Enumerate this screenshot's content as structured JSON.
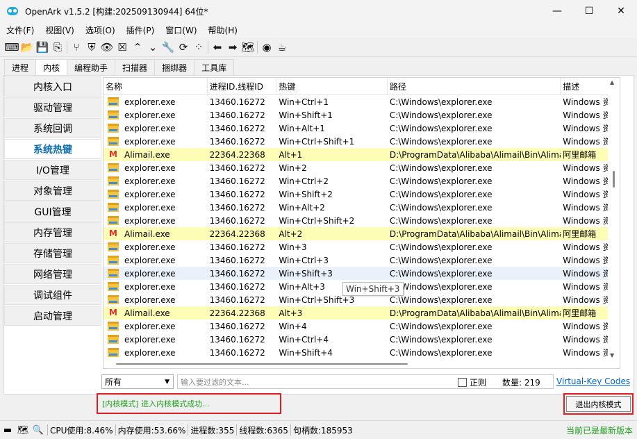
{
  "window": {
    "title": "OpenArk v1.5.2 [构建:202509130944]  64位*",
    "minimize": "—",
    "maximize": "☐",
    "close": "✕"
  },
  "menu": [
    "文件(F)",
    "视图(V)",
    "选项(O)",
    "插件(P)",
    "窗口(W)",
    "帮助(H)"
  ],
  "toolbar": {
    "icons": [
      "console-icon",
      "open-folder-icon",
      "save-icon",
      "export-icon",
      "process-tree-icon",
      "shield-icon",
      "eye-icon",
      "kill-icon",
      "up-arrow-icon",
      "down-arrow-icon",
      "wrench-icon",
      "refresh-icon",
      "grid-icon",
      "back-arrow-icon",
      "forward-arrow-icon",
      "map-icon",
      "github-icon",
      "coffee-icon"
    ]
  },
  "tabs": [
    "进程",
    "内核",
    "编程助手",
    "扫描器",
    "捆绑器",
    "工具库"
  ],
  "active_tab": "内核",
  "sidebar": [
    "内核入口",
    "驱动管理",
    "系统回调",
    "系统热键",
    "I/O管理",
    "对象管理",
    "GUI管理",
    "内存管理",
    "存储管理",
    "网络管理",
    "调试组件",
    "启动管理"
  ],
  "sidebar_active": "系统热键",
  "table": {
    "columns": [
      "名称",
      "进程ID.线程ID",
      "热键",
      "路径",
      "描述"
    ],
    "rows": [
      {
        "icon": "folder",
        "name": "explorer.exe",
        "pid": "13460.16272",
        "hotkey": "Win+Ctrl+1",
        "path": "C:\\Windows\\explorer.exe",
        "desc": "Windows 资源管理器"
      },
      {
        "icon": "folder",
        "name": "explorer.exe",
        "pid": "13460.16272",
        "hotkey": "Win+Shift+1",
        "path": "C:\\Windows\\explorer.exe",
        "desc": "Windows 资源管理器"
      },
      {
        "icon": "folder",
        "name": "explorer.exe",
        "pid": "13460.16272",
        "hotkey": "Win+Alt+1",
        "path": "C:\\Windows\\explorer.exe",
        "desc": "Windows 资源管理器"
      },
      {
        "icon": "folder",
        "name": "explorer.exe",
        "pid": "13460.16272",
        "hotkey": "Win+Ctrl+Shift+1",
        "path": "C:\\Windows\\explorer.exe",
        "desc": "Windows 资源管理器"
      },
      {
        "icon": "mail",
        "name": "Alimail.exe",
        "pid": "22364.22368",
        "hotkey": "Alt+1",
        "path": "D:\\ProgramData\\Alibaba\\Alimail\\Bin\\Alimail.exe",
        "desc": "阿里邮箱",
        "highlight": true
      },
      {
        "icon": "folder",
        "name": "explorer.exe",
        "pid": "13460.16272",
        "hotkey": "Win+2",
        "path": "C:\\Windows\\explorer.exe",
        "desc": "Windows 资源管理器"
      },
      {
        "icon": "folder",
        "name": "explorer.exe",
        "pid": "13460.16272",
        "hotkey": "Win+Ctrl+2",
        "path": "C:\\Windows\\explorer.exe",
        "desc": "Windows 资源管理器"
      },
      {
        "icon": "folder",
        "name": "explorer.exe",
        "pid": "13460.16272",
        "hotkey": "Win+Shift+2",
        "path": "C:\\Windows\\explorer.exe",
        "desc": "Windows 资源管理器"
      },
      {
        "icon": "folder",
        "name": "explorer.exe",
        "pid": "13460.16272",
        "hotkey": "Win+Alt+2",
        "path": "C:\\Windows\\explorer.exe",
        "desc": "Windows 资源管理器"
      },
      {
        "icon": "folder",
        "name": "explorer.exe",
        "pid": "13460.16272",
        "hotkey": "Win+Ctrl+Shift+2",
        "path": "C:\\Windows\\explorer.exe",
        "desc": "Windows 资源管理器"
      },
      {
        "icon": "mail",
        "name": "Alimail.exe",
        "pid": "22364.22368",
        "hotkey": "Alt+2",
        "path": "D:\\ProgramData\\Alibaba\\Alimail\\Bin\\Alimail.exe",
        "desc": "阿里邮箱",
        "highlight": true
      },
      {
        "icon": "folder",
        "name": "explorer.exe",
        "pid": "13460.16272",
        "hotkey": "Win+3",
        "path": "C:\\Windows\\explorer.exe",
        "desc": "Windows 资源管理器"
      },
      {
        "icon": "folder",
        "name": "explorer.exe",
        "pid": "13460.16272",
        "hotkey": "Win+Ctrl+3",
        "path": "C:\\Windows\\explorer.exe",
        "desc": "Windows 资源管理器"
      },
      {
        "icon": "folder",
        "name": "explorer.exe",
        "pid": "13460.16272",
        "hotkey": "Win+Shift+3",
        "path": "C:\\Windows\\explorer.exe",
        "desc": "Windows 资源管理器",
        "hover": true
      },
      {
        "icon": "folder",
        "name": "explorer.exe",
        "pid": "13460.16272",
        "hotkey": "Win+Alt+3",
        "path": "C:\\Windows\\explorer.exe",
        "desc": "Windows 资源管理器"
      },
      {
        "icon": "folder",
        "name": "explorer.exe",
        "pid": "13460.16272",
        "hotkey": "Win+Ctrl+Shift+3",
        "path": "C:\\Windows\\explorer.exe",
        "desc": "Windows 资源管理器"
      },
      {
        "icon": "mail",
        "name": "Alimail.exe",
        "pid": "22364.22368",
        "hotkey": "Alt+3",
        "path": "D:\\ProgramData\\Alibaba\\Alimail\\Bin\\Alimail.exe",
        "desc": "阿里邮箱",
        "highlight": true
      },
      {
        "icon": "folder",
        "name": "explorer.exe",
        "pid": "13460.16272",
        "hotkey": "Win+4",
        "path": "C:\\Windows\\explorer.exe",
        "desc": "Windows 资源管理器"
      },
      {
        "icon": "folder",
        "name": "explorer.exe",
        "pid": "13460.16272",
        "hotkey": "Win+Ctrl+4",
        "path": "C:\\Windows\\explorer.exe",
        "desc": "Windows 资源管理器"
      },
      {
        "icon": "folder",
        "name": "explorer.exe",
        "pid": "13460.16272",
        "hotkey": "Win+Shift+4",
        "path": "C:\\Windows\\explorer.exe",
        "desc": "Windows 资源管理器"
      }
    ]
  },
  "tooltip": "Win+Shift+3",
  "filter": {
    "select_value": "所有",
    "placeholder": "输入要过滤的文本...",
    "regex_label": "正则",
    "count_label": "数量:",
    "count": "219",
    "vk_link": "Virtual-Key Codes"
  },
  "log": "[内核模式] 进入内核模式成功...",
  "exit_button": "退出内核模式",
  "status": {
    "cpu": "CPU使用:8.46%",
    "mem": "内存使用:53.66%",
    "procs": "进程数:355",
    "threads": "线程数:6365",
    "handles": "句柄数:185953",
    "update": "当前已是最新版本"
  },
  "colors": {
    "highlight_row": "#fdfdb6",
    "active_sidebar": "#0d6fb0",
    "log_text": "#1e9e1e",
    "red_box": "#e02020",
    "link": "#0066cc"
  }
}
